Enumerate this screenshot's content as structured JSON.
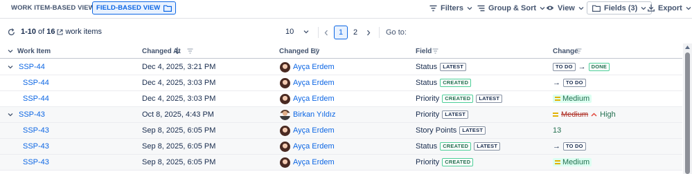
{
  "toolbar": {
    "view_work_item": "WORK ITEM-BASED VIEW",
    "view_field": "FIELD-BASED VIEW",
    "filters": "Filters",
    "group_sort": "Group & Sort",
    "view": "View",
    "fields": "Fields (3)",
    "export": "Export"
  },
  "pagination": {
    "range": "1-10",
    "of": "of",
    "total": "16",
    "label": "work items",
    "page_size": "10",
    "pages": [
      "1",
      "2"
    ],
    "goto_label": "Go to:"
  },
  "columns": {
    "work_item": "Work Item",
    "changed_at": "Changed At",
    "changed_by": "Changed By",
    "field": "Field",
    "change": "Change"
  },
  "rows": [
    {
      "key": "SSP-44",
      "changed_at": "Dec 4, 2025, 3:21 PM",
      "changed_by": "Ayça Erdem",
      "field": "Status",
      "badges": [
        "LATEST"
      ],
      "change_from": "TO DO",
      "change_to": "DONE"
    },
    {
      "key": "SSP-44",
      "changed_at": "Dec 4, 2025, 3:03 PM",
      "changed_by": "Ayça Erdem",
      "field": "Status",
      "badges": [
        "CREATED"
      ],
      "change_to": "TO DO"
    },
    {
      "key": "SSP-44",
      "changed_at": "Dec 4, 2025, 3:03 PM",
      "changed_by": "Ayça Erdem",
      "field": "Priority",
      "badges": [
        "CREATED",
        "LATEST"
      ],
      "change_to": "Medium"
    },
    {
      "key": "SSP-43",
      "changed_at": "Oct 8, 2025, 4:43 PM",
      "changed_by": "Birkan Yıldız",
      "field": "Priority",
      "badges": [
        "LATEST"
      ],
      "change_from": "Medium",
      "change_to": "High"
    },
    {
      "key": "SSP-43",
      "changed_at": "Sep 8, 2025, 6:05 PM",
      "changed_by": "Ayça Erdem",
      "field": "Story Points",
      "badges": [
        "LATEST"
      ],
      "change_to": "13"
    },
    {
      "key": "SSP-43",
      "changed_at": "Sep 8, 2025, 6:05 PM",
      "changed_by": "Ayça Erdem",
      "field": "Status",
      "badges": [
        "CREATED",
        "LATEST"
      ],
      "change_to": "TO DO"
    },
    {
      "key": "SSP-43",
      "changed_at": "Sep 8, 2025, 6:05 PM",
      "changed_by": "Ayça Erdem",
      "field": "Priority",
      "badges": [
        "CREATED"
      ],
      "change_to": "Medium"
    }
  ],
  "colors": {
    "accent": "#0c66e4",
    "green": "#216e4e",
    "red": "#ae2e24",
    "medium": "#e2b203"
  }
}
